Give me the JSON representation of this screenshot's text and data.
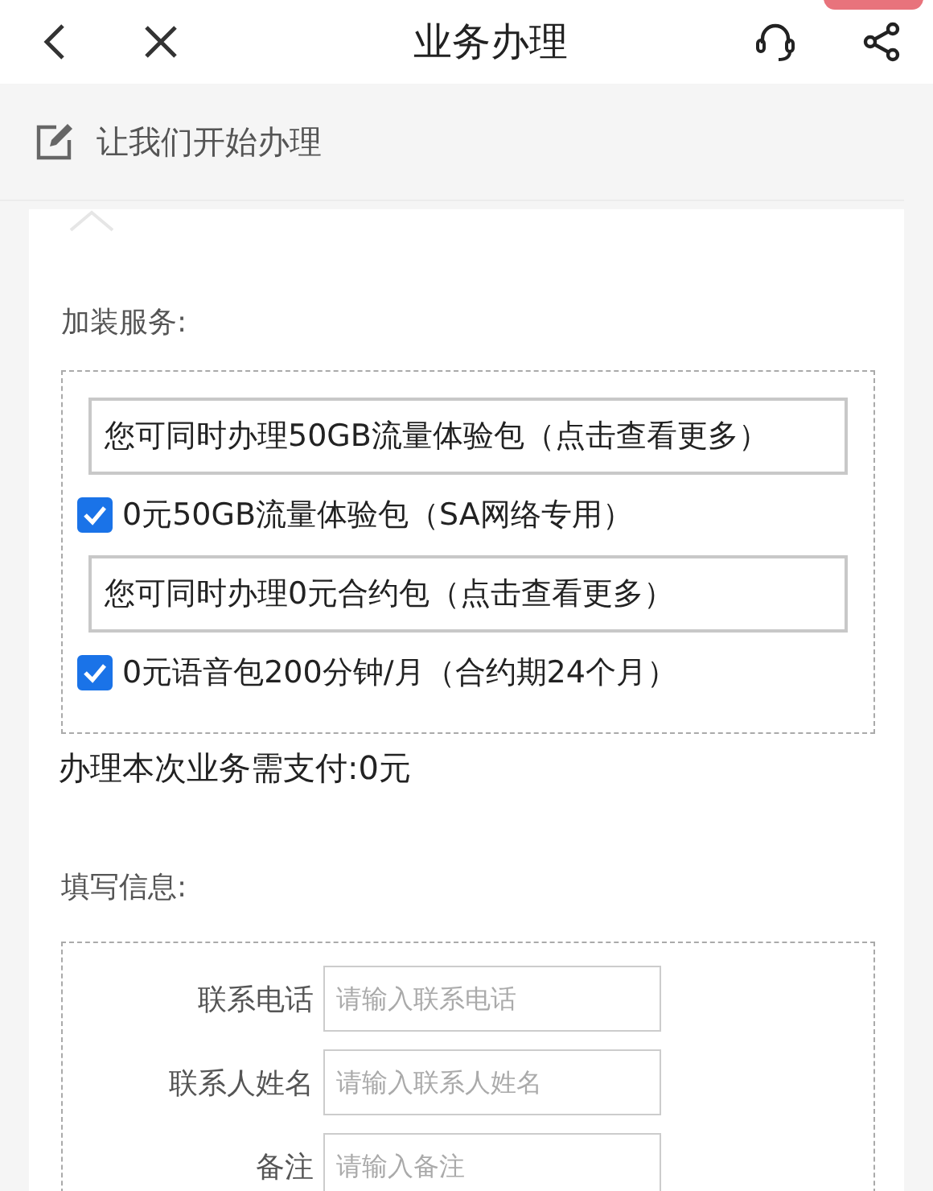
{
  "header": {
    "title": "业务办理",
    "badge": true
  },
  "section_title": "让我们开始办理",
  "addons": {
    "label": "加装服务:",
    "items": [
      {
        "kind": "notice",
        "text": "您可同时办理50GB流量体验包（点击查看更多）"
      },
      {
        "kind": "checkbox",
        "text": "0元50GB流量体验包（SA网络专用）",
        "checked": true
      },
      {
        "kind": "notice",
        "text": "您可同时办理0元合约包（点击查看更多）"
      },
      {
        "kind": "checkbox",
        "text": "0元语音包200分钟/月（合约期24个月）",
        "checked": true
      }
    ]
  },
  "payment": "办理本次业务需支付:0元",
  "form": {
    "label": "填写信息:",
    "fields": [
      {
        "label": "联系电话",
        "placeholder": "请输入联系电话"
      },
      {
        "label": "联系人姓名",
        "placeholder": "请输入联系人姓名"
      },
      {
        "label": "备注",
        "placeholder": "请输入备注"
      }
    ]
  }
}
